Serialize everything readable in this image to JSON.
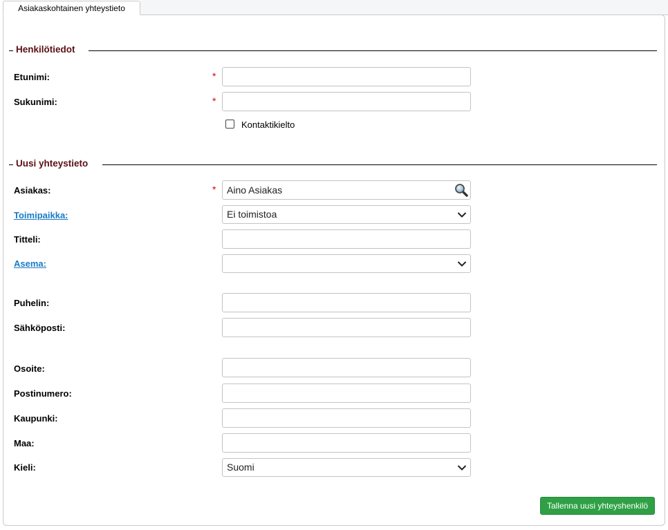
{
  "tab": {
    "label": "Asiakaskohtainen yhteystieto"
  },
  "sections": {
    "personal": {
      "title": "Henkilötiedot"
    },
    "contact": {
      "title": "Uusi yhteystieto"
    }
  },
  "fields": {
    "etunimi": {
      "label": "Etunimi:",
      "value": ""
    },
    "sukunimi": {
      "label": "Sukunimi:",
      "value": ""
    },
    "kontaktikielto": {
      "label": "Kontaktikielto",
      "checked": false
    },
    "asiakas": {
      "label": "Asiakas:",
      "value": "Aino Asiakas"
    },
    "toimipaikka": {
      "label": "Toimipaikka:",
      "value": "Ei toimistoa"
    },
    "titteli": {
      "label": "Titteli:",
      "value": ""
    },
    "asema": {
      "label": "Asema:",
      "value": ""
    },
    "puhelin": {
      "label": "Puhelin:",
      "value": ""
    },
    "sahkoposti": {
      "label": "Sähköposti:",
      "value": ""
    },
    "osoite": {
      "label": "Osoite:",
      "value": ""
    },
    "postinumero": {
      "label": "Postinumero:",
      "value": ""
    },
    "kaupunki": {
      "label": "Kaupunki:",
      "value": ""
    },
    "maa": {
      "label": "Maa:",
      "value": ""
    },
    "kieli": {
      "label": "Kieli:",
      "value": "Suomi"
    }
  },
  "required_marker": "*",
  "actions": {
    "save_label": "Tallenna uusi yhteyshenkilö"
  },
  "colors": {
    "section_title": "#5a1014",
    "link_label": "#1a7bc4",
    "required": "#e00000",
    "save_button": "#2fa045"
  },
  "icons": {
    "search": "magnifier-icon",
    "dropdown": "chevron-down-icon"
  }
}
